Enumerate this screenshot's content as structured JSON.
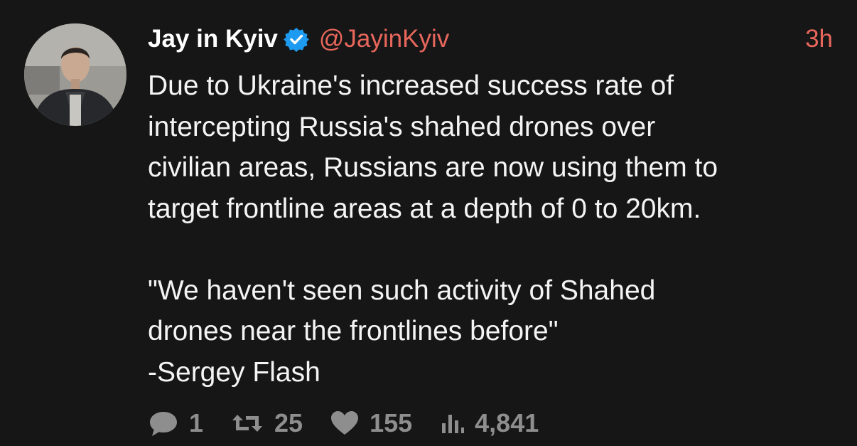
{
  "tweet": {
    "author": {
      "display_name": "Jay in Kyiv",
      "handle": "@JayinKyiv",
      "verified": true
    },
    "time": "3h",
    "paragraphs": [
      "Due to Ukraine's increased success rate of\nintercepting Russia's shahed drones over\ncivilian areas, Russians are now using them to\ntarget frontline areas at a depth of 0 to 20km.",
      "\"We haven't seen such activity of Shahed\ndrones near the frontlines before\"\n-Sergey Flash"
    ],
    "stats": {
      "replies": "1",
      "retweets": "25",
      "likes": "155",
      "views": "4,841"
    }
  },
  "colors": {
    "background": "#161616",
    "accent": "#e8675c",
    "verified_badge": "#1d9bf0",
    "muted": "#8e8e8e"
  },
  "icons": {
    "replies": "speech-bubble-icon",
    "retweets": "retweet-icon",
    "likes": "heart-icon",
    "views": "bar-chart-icon",
    "verified": "verified-badge-icon"
  }
}
